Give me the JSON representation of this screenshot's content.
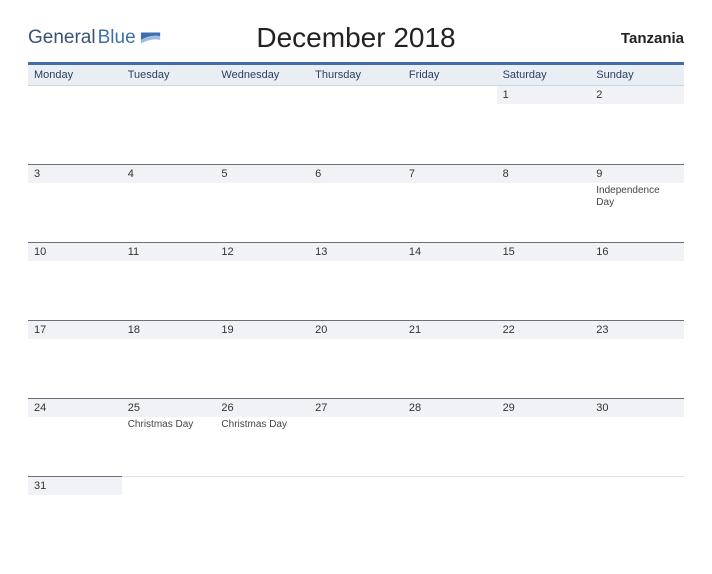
{
  "brand": {
    "part1": "General",
    "part2": "Blue"
  },
  "title": "December 2018",
  "country": "Tanzania",
  "daynames": [
    "Monday",
    "Tuesday",
    "Wednesday",
    "Thursday",
    "Friday",
    "Saturday",
    "Sunday"
  ],
  "weeks": [
    [
      {
        "day": "",
        "event": ""
      },
      {
        "day": "",
        "event": ""
      },
      {
        "day": "",
        "event": ""
      },
      {
        "day": "",
        "event": ""
      },
      {
        "day": "",
        "event": ""
      },
      {
        "day": "1",
        "event": ""
      },
      {
        "day": "2",
        "event": ""
      }
    ],
    [
      {
        "day": "3",
        "event": ""
      },
      {
        "day": "4",
        "event": ""
      },
      {
        "day": "5",
        "event": ""
      },
      {
        "day": "6",
        "event": ""
      },
      {
        "day": "7",
        "event": ""
      },
      {
        "day": "8",
        "event": ""
      },
      {
        "day": "9",
        "event": "Independence Day"
      }
    ],
    [
      {
        "day": "10",
        "event": ""
      },
      {
        "day": "11",
        "event": ""
      },
      {
        "day": "12",
        "event": ""
      },
      {
        "day": "13",
        "event": ""
      },
      {
        "day": "14",
        "event": ""
      },
      {
        "day": "15",
        "event": ""
      },
      {
        "day": "16",
        "event": ""
      }
    ],
    [
      {
        "day": "17",
        "event": ""
      },
      {
        "day": "18",
        "event": ""
      },
      {
        "day": "19",
        "event": ""
      },
      {
        "day": "20",
        "event": ""
      },
      {
        "day": "21",
        "event": ""
      },
      {
        "day": "22",
        "event": ""
      },
      {
        "day": "23",
        "event": ""
      }
    ],
    [
      {
        "day": "24",
        "event": ""
      },
      {
        "day": "25",
        "event": "Christmas Day"
      },
      {
        "day": "26",
        "event": "Christmas Day"
      },
      {
        "day": "27",
        "event": ""
      },
      {
        "day": "28",
        "event": ""
      },
      {
        "day": "29",
        "event": ""
      },
      {
        "day": "30",
        "event": ""
      }
    ],
    [
      {
        "day": "31",
        "event": ""
      },
      {
        "day": "",
        "event": ""
      },
      {
        "day": "",
        "event": ""
      },
      {
        "day": "",
        "event": ""
      },
      {
        "day": "",
        "event": ""
      },
      {
        "day": "",
        "event": ""
      },
      {
        "day": "",
        "event": ""
      }
    ]
  ]
}
